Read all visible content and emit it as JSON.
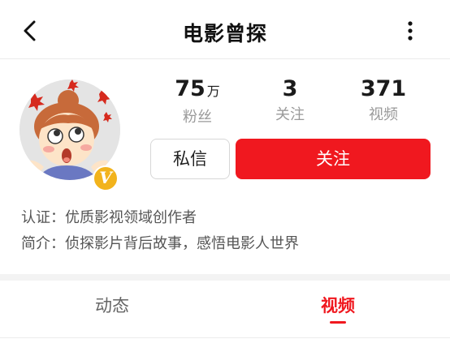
{
  "header": {
    "title": "电影曾探",
    "back_icon": "chevron-left-icon",
    "more_icon": "more-vertical-icon"
  },
  "profile": {
    "avatar_badge": "V",
    "stats": [
      {
        "value": "75",
        "unit": "万",
        "label": "粉丝"
      },
      {
        "value": "3",
        "unit": "",
        "label": "关注"
      },
      {
        "value": "371",
        "unit": "",
        "label": "视频"
      }
    ],
    "message_button": "私信",
    "follow_button": "关注",
    "certification": "认证：优质影视领域创作者",
    "bio": "简介：侦探影片背后故事，感悟电影人世界"
  },
  "tabs": [
    {
      "label": "动态",
      "active": false
    },
    {
      "label": "视频",
      "active": true
    }
  ],
  "colors": {
    "accent": "#f0181f",
    "badge": "#f2b31c",
    "muted_text": "#9a9a9a"
  }
}
